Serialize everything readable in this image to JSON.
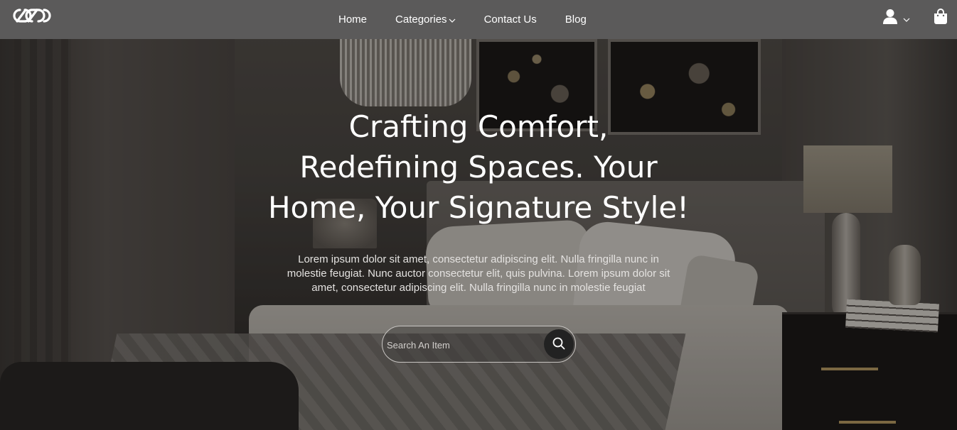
{
  "nav": {
    "logo_icon": "linked-rings-logo",
    "links": [
      {
        "label": "Home"
      },
      {
        "label": "Categories",
        "icon": "chevron-down-icon"
      },
      {
        "label": "Contact Us"
      },
      {
        "label": "Blog"
      }
    ],
    "user_icon": "user-icon",
    "user_chevron_icon": "chevron-down-icon",
    "cart_icon": "shopping-bag-icon"
  },
  "hero": {
    "headline": "Crafting Comfort, Redefining Spaces. Your Home, Your Signature Style!",
    "subtext": "Lorem ipsum dolor sit amet, consectetur adipiscing elit. Nulla fringilla nunc in molestie feugiat. Nunc auctor consectetur elit, quis pulvina. Lorem ipsum dolor sit amet, consectetur adipiscing elit. Nulla fringilla nunc in molestie feugiat",
    "background": "bedroom-interior-photo"
  },
  "search": {
    "placeholder": "Search An Item",
    "value": "",
    "button_icon": "search-icon"
  },
  "colors": {
    "navbar_bg": "#5b5a5a",
    "text_primary": "#ffffff",
    "search_button_bg": "#222222"
  }
}
